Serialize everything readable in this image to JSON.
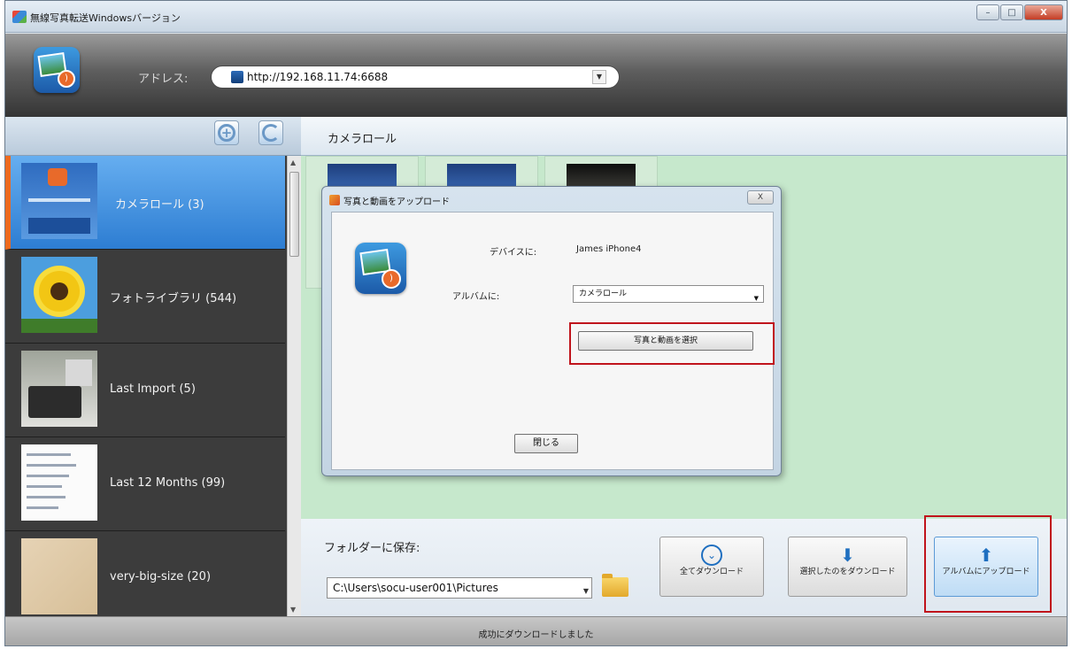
{
  "window": {
    "title": "無線写真転送Windowsバージョン",
    "controls": {
      "minimize": "–",
      "maximize": "□",
      "close": "X"
    }
  },
  "header": {
    "address_label": "アドレス:",
    "address_value": "http://192.168.11.74:6688"
  },
  "toolbar": {
    "add_icon": "plus-circle-icon",
    "refresh_icon": "refresh-icon",
    "current_album": "カメラロール"
  },
  "sidebar": {
    "albums": [
      {
        "label": "カメラロール (3)",
        "selected": true
      },
      {
        "label": "フォトライブラリ (544)",
        "selected": false
      },
      {
        "label": "Last Import (5)",
        "selected": false
      },
      {
        "label": "Last 12 Months (99)",
        "selected": false
      },
      {
        "label": "very-big-size (20)",
        "selected": false
      }
    ]
  },
  "dialog": {
    "title": "写真と動画をアップロード",
    "close_glyph": "X",
    "device_label": "デバイスに:",
    "device_value": "James iPhone4",
    "album_label": "アルバムに:",
    "album_value": "カメラロール",
    "select_button": "写真と動画を選択",
    "close_button": "閉じる"
  },
  "bottom": {
    "save_label": "フォルダーに保存:",
    "path_value": "C:\\Users\\socu-user001\\Pictures",
    "download_all": "全てダウンロード",
    "download_selected": "選択したのをダウンロード",
    "upload_album": "アルバムにアップロード"
  },
  "status": {
    "message": "成功にダウンロードしました"
  },
  "colors": {
    "accent": "#2d7dd2",
    "selection_marker": "#ee6a1e",
    "content_bg": "#c6e8cc",
    "highlight_box": "#c0141c"
  }
}
